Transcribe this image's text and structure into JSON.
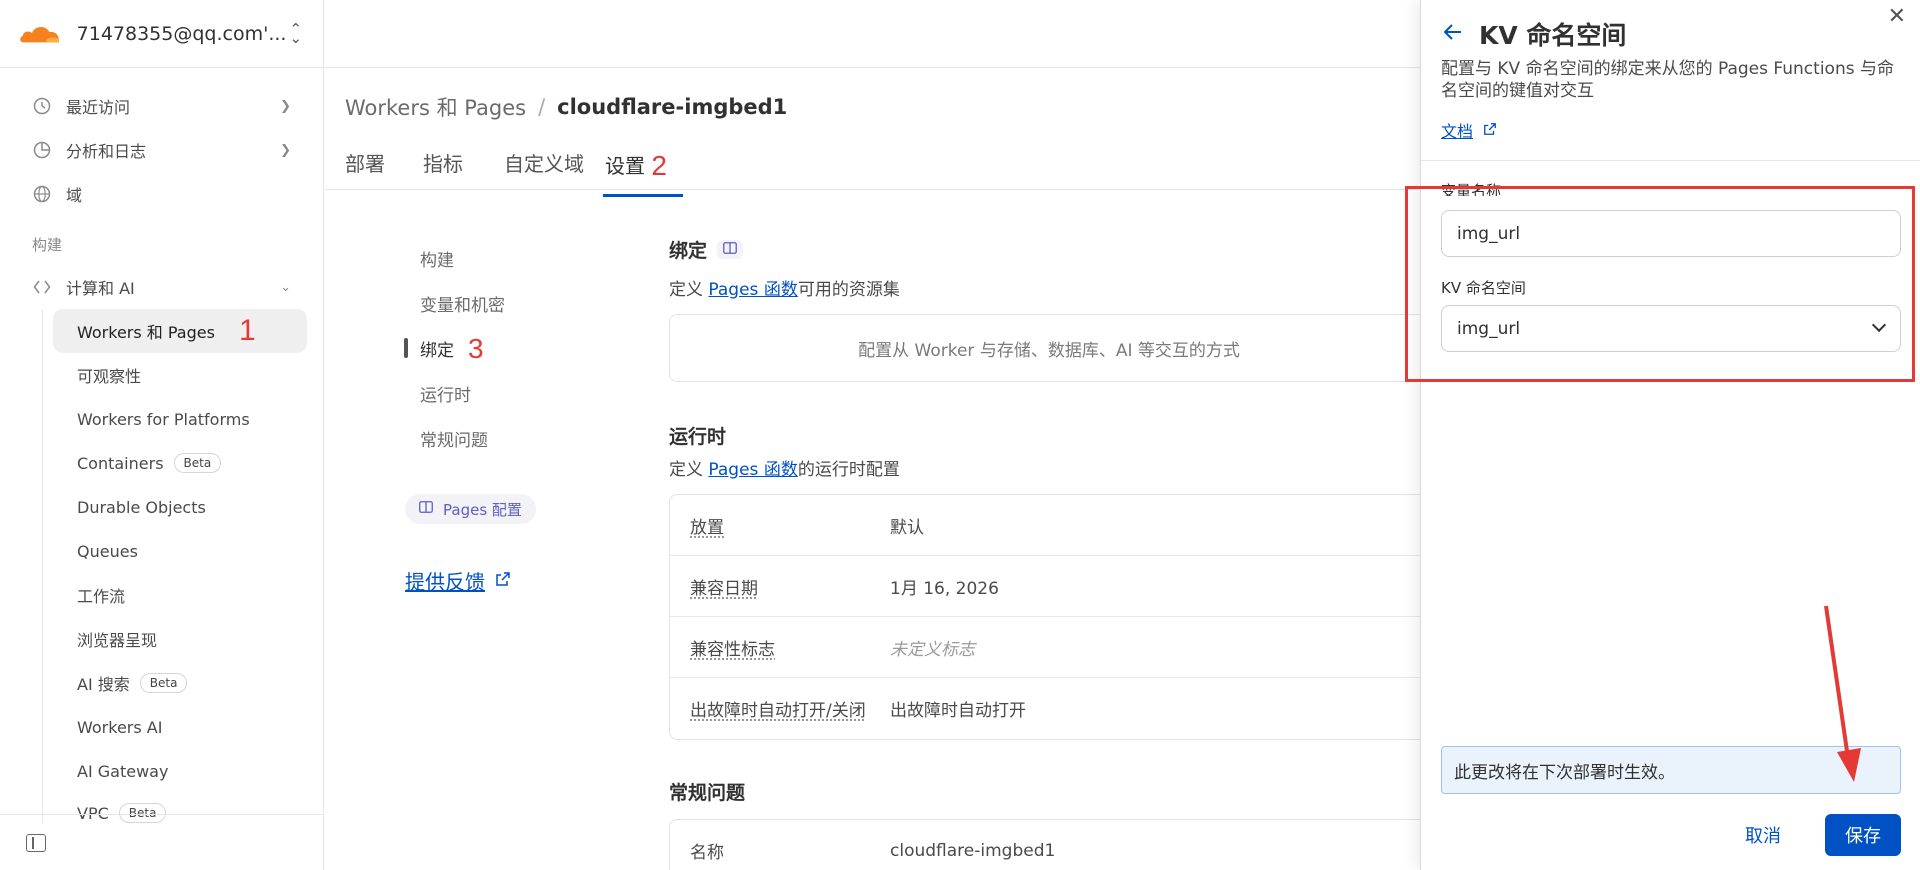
{
  "sidebar": {
    "account": "71478355@qq.com'...",
    "nav": [
      {
        "label": "最近访问",
        "icon": "clock-icon"
      },
      {
        "label": "分析和日志",
        "icon": "chart-pie-icon"
      },
      {
        "label": "域",
        "icon": "globe-icon"
      }
    ],
    "section": "构建",
    "group": {
      "label": "计算和 AI",
      "icon": "compute-icon"
    },
    "sub_items": [
      {
        "label": "Workers 和 Pages"
      },
      {
        "label": "可观察性"
      },
      {
        "label": "Workers for Platforms"
      },
      {
        "label": "Containers",
        "badge": "Beta"
      },
      {
        "label": "Durable Objects"
      },
      {
        "label": "Queues"
      },
      {
        "label": "工作流"
      },
      {
        "label": "浏览器呈现"
      },
      {
        "label": "AI 搜索",
        "badge": "Beta"
      },
      {
        "label": "Workers AI"
      },
      {
        "label": "AI Gateway"
      },
      {
        "label": "VPC",
        "badge": "Beta"
      }
    ]
  },
  "annotations": {
    "a1": "1",
    "a2": "2",
    "a3": "3"
  },
  "breadcrumb": {
    "parent": "Workers 和 Pages",
    "sep": "/",
    "current": "cloudflare-imgbed1"
  },
  "tabs": [
    "部署",
    "指标",
    "自定义域",
    "设置"
  ],
  "subnav": [
    "构建",
    "变量和机密",
    "绑定",
    "运行时",
    "常规问题"
  ],
  "pages_config": "Pages 配置",
  "feedback": "提供反馈",
  "bindings": {
    "title": "绑定",
    "desc_pre": "定义",
    "desc_link": "Pages 函数",
    "desc_post": "可用的资源集",
    "empty": "配置从 Worker 与存储、数据库、AI 等交互的方式"
  },
  "runtime": {
    "title": "运行时",
    "desc_pre": "定义",
    "desc_link": "Pages 函数",
    "desc_post": "的运行时配置",
    "rows": [
      {
        "key": "放置",
        "value": "默认"
      },
      {
        "key": "兼容日期",
        "value": "1月 16, 2026"
      },
      {
        "key": "兼容性标志",
        "value": "未定义标志"
      },
      {
        "key": "出故障时自动打开/关闭",
        "value": "出故障时自动打开"
      }
    ]
  },
  "faq": {
    "title": "常规问题",
    "rows": [
      {
        "key": "名称",
        "value": "cloudflare-imgbed1"
      }
    ]
  },
  "drawer": {
    "title": "KV 命名空间",
    "desc": "配置与 KV 命名空间的绑定来从您的 Pages Functions 与命名空间的键值对交互",
    "doc_link": "文档",
    "var_label": "变量名称",
    "var_value": "img_url",
    "ns_label": "KV 命名空间",
    "ns_value": "img_url",
    "notice": "此更改将在下次部署时生效。",
    "cancel": "取消",
    "save": "保存"
  },
  "colors": {
    "accent": "#0051c3",
    "annotation": "#e53935",
    "brand": "#f6821f"
  }
}
